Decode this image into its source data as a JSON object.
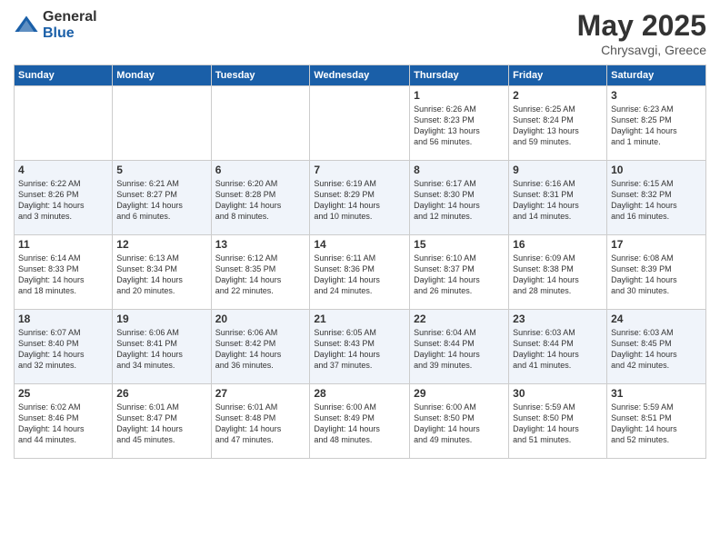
{
  "logo": {
    "general": "General",
    "blue": "Blue"
  },
  "title": {
    "month": "May 2025",
    "location": "Chrysavgi, Greece"
  },
  "weekdays": [
    "Sunday",
    "Monday",
    "Tuesday",
    "Wednesday",
    "Thursday",
    "Friday",
    "Saturday"
  ],
  "weeks": [
    [
      {
        "day": "",
        "info": ""
      },
      {
        "day": "",
        "info": ""
      },
      {
        "day": "",
        "info": ""
      },
      {
        "day": "",
        "info": ""
      },
      {
        "day": "1",
        "info": "Sunrise: 6:26 AM\nSunset: 8:23 PM\nDaylight: 13 hours\nand 56 minutes."
      },
      {
        "day": "2",
        "info": "Sunrise: 6:25 AM\nSunset: 8:24 PM\nDaylight: 13 hours\nand 59 minutes."
      },
      {
        "day": "3",
        "info": "Sunrise: 6:23 AM\nSunset: 8:25 PM\nDaylight: 14 hours\nand 1 minute."
      }
    ],
    [
      {
        "day": "4",
        "info": "Sunrise: 6:22 AM\nSunset: 8:26 PM\nDaylight: 14 hours\nand 3 minutes."
      },
      {
        "day": "5",
        "info": "Sunrise: 6:21 AM\nSunset: 8:27 PM\nDaylight: 14 hours\nand 6 minutes."
      },
      {
        "day": "6",
        "info": "Sunrise: 6:20 AM\nSunset: 8:28 PM\nDaylight: 14 hours\nand 8 minutes."
      },
      {
        "day": "7",
        "info": "Sunrise: 6:19 AM\nSunset: 8:29 PM\nDaylight: 14 hours\nand 10 minutes."
      },
      {
        "day": "8",
        "info": "Sunrise: 6:17 AM\nSunset: 8:30 PM\nDaylight: 14 hours\nand 12 minutes."
      },
      {
        "day": "9",
        "info": "Sunrise: 6:16 AM\nSunset: 8:31 PM\nDaylight: 14 hours\nand 14 minutes."
      },
      {
        "day": "10",
        "info": "Sunrise: 6:15 AM\nSunset: 8:32 PM\nDaylight: 14 hours\nand 16 minutes."
      }
    ],
    [
      {
        "day": "11",
        "info": "Sunrise: 6:14 AM\nSunset: 8:33 PM\nDaylight: 14 hours\nand 18 minutes."
      },
      {
        "day": "12",
        "info": "Sunrise: 6:13 AM\nSunset: 8:34 PM\nDaylight: 14 hours\nand 20 minutes."
      },
      {
        "day": "13",
        "info": "Sunrise: 6:12 AM\nSunset: 8:35 PM\nDaylight: 14 hours\nand 22 minutes."
      },
      {
        "day": "14",
        "info": "Sunrise: 6:11 AM\nSunset: 8:36 PM\nDaylight: 14 hours\nand 24 minutes."
      },
      {
        "day": "15",
        "info": "Sunrise: 6:10 AM\nSunset: 8:37 PM\nDaylight: 14 hours\nand 26 minutes."
      },
      {
        "day": "16",
        "info": "Sunrise: 6:09 AM\nSunset: 8:38 PM\nDaylight: 14 hours\nand 28 minutes."
      },
      {
        "day": "17",
        "info": "Sunrise: 6:08 AM\nSunset: 8:39 PM\nDaylight: 14 hours\nand 30 minutes."
      }
    ],
    [
      {
        "day": "18",
        "info": "Sunrise: 6:07 AM\nSunset: 8:40 PM\nDaylight: 14 hours\nand 32 minutes."
      },
      {
        "day": "19",
        "info": "Sunrise: 6:06 AM\nSunset: 8:41 PM\nDaylight: 14 hours\nand 34 minutes."
      },
      {
        "day": "20",
        "info": "Sunrise: 6:06 AM\nSunset: 8:42 PM\nDaylight: 14 hours\nand 36 minutes."
      },
      {
        "day": "21",
        "info": "Sunrise: 6:05 AM\nSunset: 8:43 PM\nDaylight: 14 hours\nand 37 minutes."
      },
      {
        "day": "22",
        "info": "Sunrise: 6:04 AM\nSunset: 8:44 PM\nDaylight: 14 hours\nand 39 minutes."
      },
      {
        "day": "23",
        "info": "Sunrise: 6:03 AM\nSunset: 8:44 PM\nDaylight: 14 hours\nand 41 minutes."
      },
      {
        "day": "24",
        "info": "Sunrise: 6:03 AM\nSunset: 8:45 PM\nDaylight: 14 hours\nand 42 minutes."
      }
    ],
    [
      {
        "day": "25",
        "info": "Sunrise: 6:02 AM\nSunset: 8:46 PM\nDaylight: 14 hours\nand 44 minutes."
      },
      {
        "day": "26",
        "info": "Sunrise: 6:01 AM\nSunset: 8:47 PM\nDaylight: 14 hours\nand 45 minutes."
      },
      {
        "day": "27",
        "info": "Sunrise: 6:01 AM\nSunset: 8:48 PM\nDaylight: 14 hours\nand 47 minutes."
      },
      {
        "day": "28",
        "info": "Sunrise: 6:00 AM\nSunset: 8:49 PM\nDaylight: 14 hours\nand 48 minutes."
      },
      {
        "day": "29",
        "info": "Sunrise: 6:00 AM\nSunset: 8:50 PM\nDaylight: 14 hours\nand 49 minutes."
      },
      {
        "day": "30",
        "info": "Sunrise: 5:59 AM\nSunset: 8:50 PM\nDaylight: 14 hours\nand 51 minutes."
      },
      {
        "day": "31",
        "info": "Sunrise: 5:59 AM\nSunset: 8:51 PM\nDaylight: 14 hours\nand 52 minutes."
      }
    ]
  ]
}
